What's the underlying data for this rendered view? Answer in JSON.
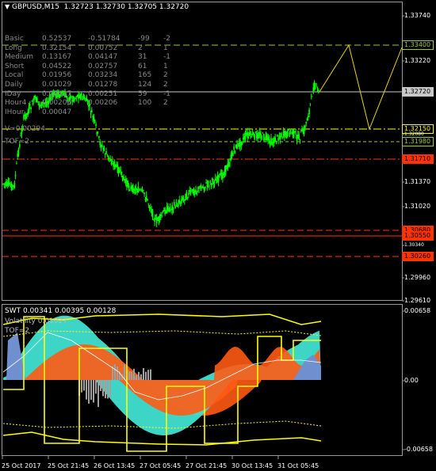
{
  "chart": {
    "title": "GBPUSD,M15",
    "ohlc": "1.32723 1.32730 1.32705 1.32720",
    "info_rows": [
      {
        "name": "Basic",
        "v1": "0.52537",
        "v2": "-0.51784",
        "v3": "-99",
        "v4": "-2"
      },
      {
        "name": "Long",
        "v1": "0.32154",
        "v2": "0.00752",
        "v3": "2",
        "v4": "1"
      },
      {
        "name": "Medium",
        "v1": "0.13167",
        "v2": "0.04147",
        "v3": "31",
        "v4": "-1"
      },
      {
        "name": "Short",
        "v1": "0.04522",
        "v2": "0.02757",
        "v3": "61",
        "v4": "1"
      },
      {
        "name": "Local",
        "v1": "0.01956",
        "v2": "0.03234",
        "v3": "165",
        "v4": "2"
      },
      {
        "name": "Daily",
        "v1": "0.01029",
        "v2": "0.01278",
        "v3": "124",
        "v4": "2"
      },
      {
        "name": "IDay",
        "v1": "0.00427",
        "v2": "0.00251",
        "v3": "59",
        "v4": "-1"
      },
      {
        "name": "Hour4",
        "v1": "0.00206",
        "v2": "0.00206",
        "v3": "100",
        "v4": "2"
      },
      {
        "name": "IHour",
        "v1": "0.00047",
        "v2": "",
        "v3": "",
        "v4": ""
      }
    ],
    "v_label": "V=0.00294",
    "tof_label": "TOF=2",
    "price_axis": [
      "1.33740",
      "1.33400",
      "1.33220",
      "1.32720",
      "1.32150",
      "1.32080",
      "1.31980",
      "1.31710",
      "1.31370",
      "1.31020",
      "1.30680",
      "1.30550",
      "1.30340",
      "1.30260",
      "1.29960",
      "1.29610"
    ],
    "level_colors": {
      "green": "#9acd32",
      "yellow": "#ffff00",
      "red": "#ff3300",
      "gray": "#c8c8c8",
      "candle": "#00ff00",
      "forecast": "#e6d800"
    }
  },
  "indicator": {
    "title": "SWT 0.00341 0.00395 0.00128",
    "volatility": "Volatility 0.01027",
    "tof": "TOF=2",
    "axis": [
      "0.00658",
      "0.00",
      "-0.00658"
    ],
    "colors": {
      "orange": "#ff5a14",
      "teal": "#40e0d0",
      "blue": "#6f8fce",
      "gray": "#a0a0a0",
      "yellow": "#ffff00"
    }
  },
  "time_axis": [
    "25 Oct 2017",
    "25 Oct 21:45",
    "26 Oct 13:45",
    "27 Oct 05:45",
    "27 Oct 21:45",
    "30 Oct 13:45",
    "31 Oct 05:45"
  ]
}
